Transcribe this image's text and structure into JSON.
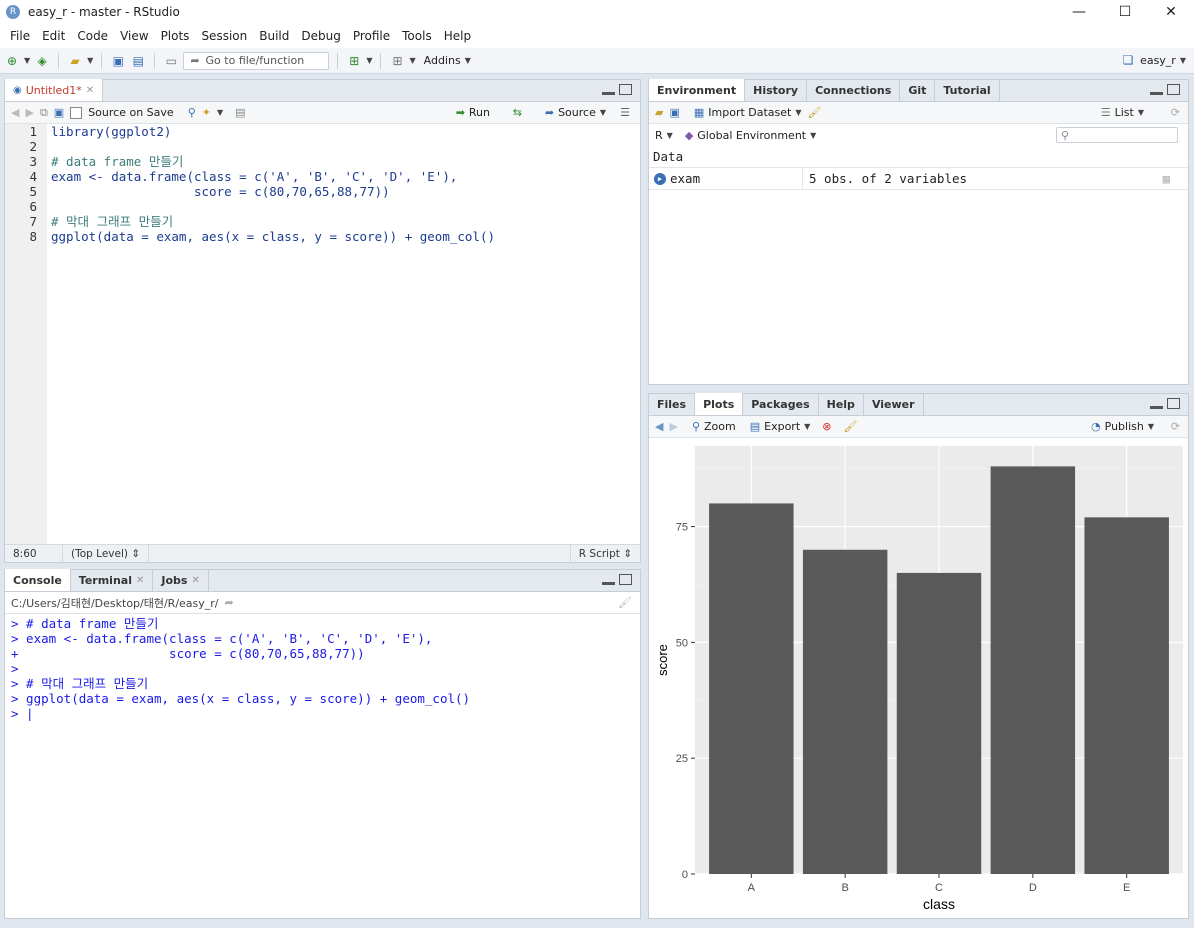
{
  "window": {
    "title": "easy_r - master - RStudio",
    "logo": "R",
    "minimize": "—",
    "maximize": "☐",
    "close": "✕"
  },
  "menu": [
    "File",
    "Edit",
    "Code",
    "View",
    "Plots",
    "Session",
    "Build",
    "Debug",
    "Profile",
    "Tools",
    "Help"
  ],
  "toolbar": {
    "goto_placeholder": "Go to file/function",
    "addins_label": "Addins",
    "project_label": "easy_r"
  },
  "editor": {
    "tab_label": "Untitled1*",
    "source_on_save": "Source on Save",
    "run_label": "Run",
    "source_label": "Source",
    "lines": [
      "library(ggplot2)",
      "",
      "# data frame 만들기",
      "exam <- data.frame(class = c('A', 'B', 'C', 'D', 'E'),",
      "                   score = c(80,70,65,88,77))",
      "",
      "# 막대 그래프 만들기",
      "ggplot(data = exam, aes(x = class, y = score)) + geom_col()"
    ],
    "line_numbers": [
      "1",
      "2",
      "3",
      "4",
      "5",
      "6",
      "7",
      "8"
    ],
    "cursor_pos": "8:60",
    "scope": "(Top Level) ⇕",
    "file_type": "R Script ⇕"
  },
  "console": {
    "tabs": [
      "Console",
      "Terminal",
      "Jobs"
    ],
    "path": "C:/Users/김태현/Desktop/태현/R/easy_r/",
    "lines": [
      "> # data frame 만들기",
      "> exam <- data.frame(class = c('A', 'B', 'C', 'D', 'E'),",
      "+                    score = c(80,70,65,88,77))",
      ">",
      "> # 막대 그래프 만들기",
      "> ggplot(data = exam, aes(x = class, y = score)) + geom_col()",
      "> |"
    ]
  },
  "environment": {
    "tabs": [
      "Environment",
      "History",
      "Connections",
      "Git",
      "Tutorial"
    ],
    "import_label": "Import Dataset",
    "list_label": "List",
    "lang_label": "R",
    "scope_label": "Global Environment",
    "section": "Data",
    "rows": [
      {
        "name": "exam",
        "value": "5 obs. of 2 variables"
      }
    ]
  },
  "plots": {
    "tabs": [
      "Files",
      "Plots",
      "Packages",
      "Help",
      "Viewer"
    ],
    "zoom_label": "Zoom",
    "export_label": "Export",
    "publish_label": "Publish"
  },
  "colors": {
    "bar": "#595959",
    "panel_bg": "#ebebeb",
    "grid": "#ffffff",
    "comment": "#3c7c7c",
    "string": "#067d17",
    "console_text": "#1a1ae6"
  },
  "chart_data": {
    "type": "bar",
    "categories": [
      "A",
      "B",
      "C",
      "D",
      "E"
    ],
    "values": [
      80,
      70,
      65,
      88,
      77
    ],
    "xlabel": "class",
    "ylabel": "score",
    "yticks": [
      0,
      25,
      50,
      75
    ],
    "ylim": [
      0,
      92.4
    ],
    "grid": true
  }
}
